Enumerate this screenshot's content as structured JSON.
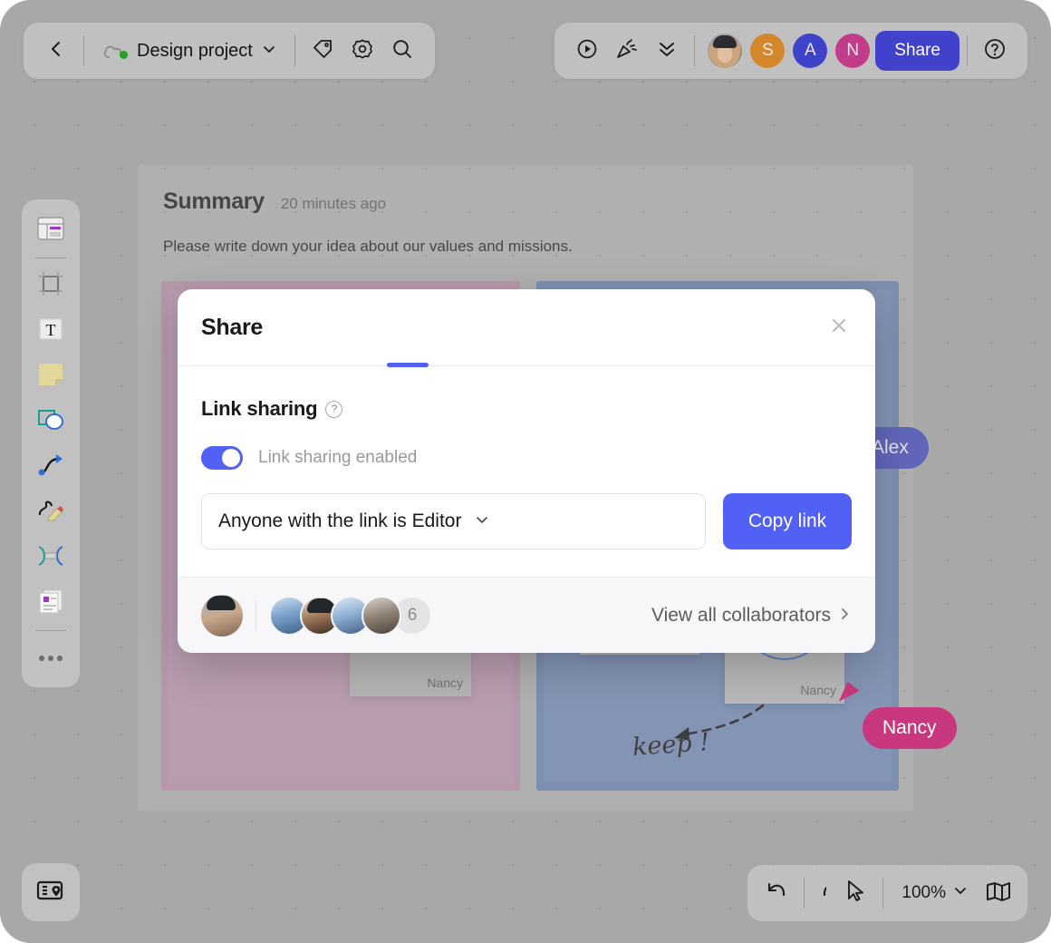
{
  "topbar": {
    "back_icon": "chevron-left-icon",
    "project_name": "Design project",
    "project_chevron": "chevron-down-icon",
    "cloud_icon": "cloud-icon",
    "tag_icon": "tag-icon",
    "settings_icon": "gear-icon",
    "search_icon": "search-icon",
    "present_icon": "play-circle-icon",
    "celebrate_icon": "party-popper-icon",
    "collapse_icon": "chevrons-down-icon",
    "share_label": "Share",
    "help_icon": "question-circle-icon",
    "avatars": [
      {
        "name": "avatar-photo",
        "initial": "",
        "color": "#8a9aaa",
        "type": "photo"
      },
      {
        "name": "avatar-s",
        "initial": "S",
        "color": "#d4872a",
        "type": "initial"
      },
      {
        "name": "avatar-a",
        "initial": "A",
        "color": "#3f43c9",
        "type": "initial"
      },
      {
        "name": "avatar-n",
        "initial": "N",
        "color": "#c23c8a",
        "type": "initial"
      }
    ]
  },
  "tool_rail": {
    "items": [
      {
        "name": "templates-icon",
        "label": "Templates"
      },
      {
        "name": "frame-icon",
        "label": "Frame"
      },
      {
        "name": "text-icon",
        "label": "Text"
      },
      {
        "name": "sticky-note-icon",
        "label": "Sticky note"
      },
      {
        "name": "shapes-icon",
        "label": "Shapes"
      },
      {
        "name": "connector-icon",
        "label": "Connector"
      },
      {
        "name": "pen-icon",
        "label": "Pen"
      },
      {
        "name": "connection-lines-icon",
        "label": "Connection lines"
      },
      {
        "name": "card-icon",
        "label": "Card"
      },
      {
        "name": "more-options-icon",
        "label": "More"
      }
    ],
    "bottom_left_icon": "minimap-location-icon"
  },
  "board": {
    "summary_title": "Summary",
    "summary_time": "20 minutes ago",
    "summary_subtitle": "Please write down your idea about our values and missions.",
    "frames": [
      {
        "name": "frame-pink",
        "color": "#bc92ae"
      },
      {
        "name": "frame-blue",
        "color": "#6b84b5"
      }
    ],
    "notes": [
      {
        "label": "Nancy"
      },
      {
        "label": ""
      },
      {
        "label": "Nancy"
      }
    ],
    "annotation": "keep !",
    "cursors": [
      {
        "name": "Alex",
        "color": "#4449c2"
      },
      {
        "name": "Nancy",
        "color": "#c9387f"
      }
    ]
  },
  "modal": {
    "title": "Share",
    "close_icon": "close-icon",
    "section_title": "Link sharing",
    "help_icon": "question-mark-icon",
    "help_glyph": "?",
    "toggle_label": "Link sharing enabled",
    "toggle_on": true,
    "permission_value": "Anyone with the link is Editor",
    "permission_chevron": "chevron-down-icon",
    "copy_label": "Copy link",
    "collaborator_count": "6",
    "view_all_label": "View all collaborators",
    "view_all_chevron": "chevron-right-icon",
    "accent_color": "#5160f5"
  },
  "bottom_bar": {
    "undo_icon": "undo-icon",
    "redo_icon": "redo-icon",
    "cursor_icon": "cursor-pointer-icon",
    "zoom_level": "100%",
    "zoom_chevron": "chevron-down-icon",
    "minimap_icon": "map-icon"
  }
}
